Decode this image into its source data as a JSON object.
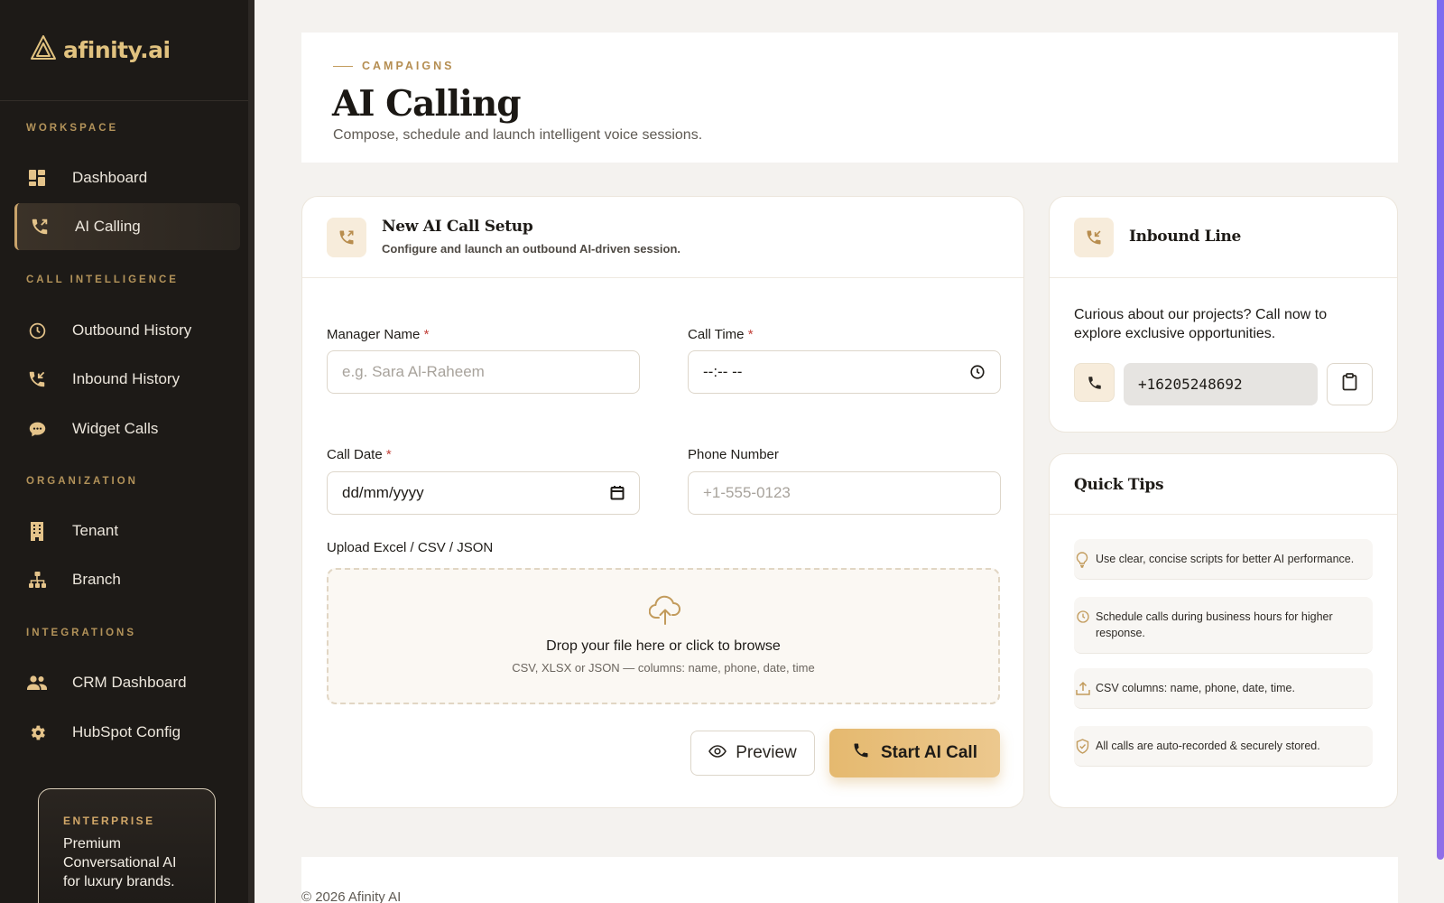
{
  "brand": {
    "name": "afinity.ai"
  },
  "sidebar": {
    "sections": {
      "workspace": "WORKSPACE",
      "call_intelligence": "CALL INTELLIGENCE",
      "organization": "ORGANIZATION",
      "integrations": "INTEGRATIONS"
    },
    "items": {
      "dashboard": "Dashboard",
      "ai_calling": "AI Calling",
      "outbound_history": "Outbound History",
      "inbound_history": "Inbound History",
      "widget_calls": "Widget Calls",
      "tenant": "Tenant",
      "branch": "Branch",
      "crm_dashboard": "CRM Dashboard",
      "hubspot_config": "HubSpot Config"
    },
    "active_item": "AI Calling",
    "enterprise": {
      "tag": "ENTERPRISE",
      "text": "Premium Conversational AI for luxury brands."
    }
  },
  "header": {
    "eyebrow": "CAMPAIGNS",
    "title": "AI Calling",
    "subtitle": "Compose, schedule and launch intelligent voice sessions."
  },
  "setup": {
    "title": "New AI Call Setup",
    "subtitle": "Configure and launch an outbound AI-driven session.",
    "required_mark": "*",
    "manager_name": {
      "label": "Manager Name",
      "placeholder": "e.g. Sara Al-Raheem"
    },
    "call_time": {
      "label": "Call Time",
      "value": "--:-- --"
    },
    "call_date": {
      "label": "Call Date",
      "value": "dd/mm/yyyy"
    },
    "phone_number": {
      "label": "Phone Number",
      "placeholder": "+1-555-0123"
    },
    "upload": {
      "label": "Upload Excel / CSV / JSON",
      "title": "Drop your file here or click to browse",
      "subtitle": "CSV, XLSX or JSON — columns: name, phone, date, time"
    },
    "preview_label": "Preview",
    "start_label": "Start AI Call"
  },
  "inbound": {
    "title": "Inbound Line",
    "text": "Curious about our projects? Call now to explore exclusive opportunities.",
    "number": "+16205248692"
  },
  "tips": {
    "title": "Quick Tips",
    "items": [
      "Use clear, concise scripts for better AI performance.",
      "Schedule calls during business hours for higher response.",
      "CSV columns: name, phone, date, time.",
      "All calls are auto-recorded & securely stored."
    ]
  },
  "footer": {
    "copyright": "© 2026 Afinity AI"
  },
  "colors": {
    "accent": "#c9a36b",
    "sidebar_bg": "#1d1a17",
    "button_gold": "#e5b96f",
    "scroll_accent": "#7d6cf0"
  }
}
